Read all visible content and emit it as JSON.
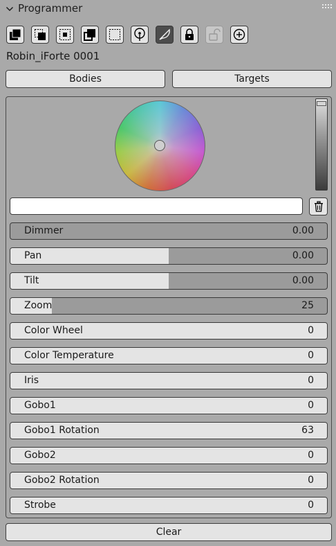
{
  "panel": {
    "title": "Programmer"
  },
  "toolbar": {
    "tools": [
      {
        "icon": "select-all-icon",
        "active": false,
        "disabled": false
      },
      {
        "icon": "select-invert-icon",
        "active": false,
        "disabled": false
      },
      {
        "icon": "select-box-center-icon",
        "active": false,
        "disabled": false
      },
      {
        "icon": "select-overlap-icon",
        "active": false,
        "disabled": false
      },
      {
        "icon": "select-box-dashed-icon",
        "active": false,
        "disabled": false
      },
      {
        "icon": "locate-pin-icon",
        "active": false,
        "disabled": false
      },
      {
        "icon": "feather-icon",
        "active": true,
        "disabled": false
      },
      {
        "icon": "lock-icon",
        "active": false,
        "disabled": false
      },
      {
        "icon": "unlock-icon",
        "active": false,
        "disabled": true
      },
      {
        "icon": "zoom-in-icon",
        "active": false,
        "disabled": false
      }
    ]
  },
  "fixture": {
    "name": "Robin_iForte 0001"
  },
  "tabs": {
    "bodies": "Bodies",
    "targets": "Targets"
  },
  "color": {
    "hex_value": "",
    "intensity_level": 0.98
  },
  "parameters": [
    {
      "label": "Dimmer",
      "value": "0.00",
      "fill": 0.0
    },
    {
      "label": "Pan",
      "value": "0.00",
      "fill": 0.5
    },
    {
      "label": "Tilt",
      "value": "0.00",
      "fill": 0.5
    },
    {
      "label": "Zoom",
      "value": "25",
      "fill": 0.13
    },
    {
      "label": "Color Wheel",
      "value": "0",
      "fill": 1.0
    },
    {
      "label": "Color Temperature",
      "value": "0",
      "fill": 1.0
    },
    {
      "label": "Iris",
      "value": "0",
      "fill": 1.0
    },
    {
      "label": "Gobo1",
      "value": "0",
      "fill": 1.0
    },
    {
      "label": "Gobo1 Rotation",
      "value": "63",
      "fill": 1.0
    },
    {
      "label": "Gobo2",
      "value": "0",
      "fill": 1.0
    },
    {
      "label": "Gobo2 Rotation",
      "value": "0",
      "fill": 1.0
    },
    {
      "label": "Strobe",
      "value": "0",
      "fill": 1.0
    }
  ],
  "actions": {
    "clear": "Clear"
  }
}
